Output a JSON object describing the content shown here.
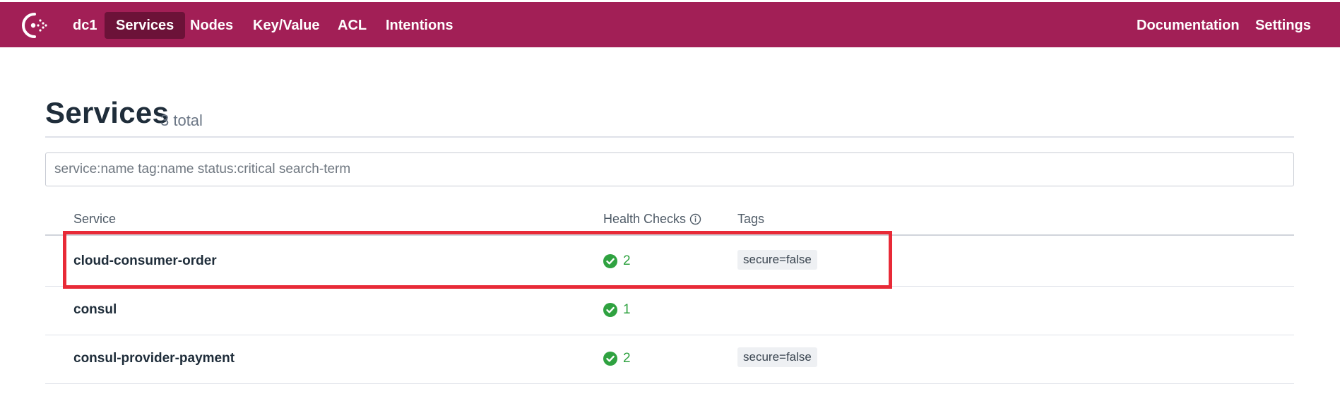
{
  "nav": {
    "datacenter": "dc1",
    "items": [
      "Services",
      "Nodes",
      "Key/Value",
      "ACL",
      "Intentions"
    ],
    "active": "Services",
    "right_items": [
      "Documentation",
      "Settings"
    ],
    "brand_color": "#a21f56",
    "logo_icon": "consul-logo-icon"
  },
  "page": {
    "title": "Services",
    "count": "3 total"
  },
  "search": {
    "placeholder": "service:name tag:name status:critical search-term",
    "value": ""
  },
  "table": {
    "headers": {
      "service": "Service",
      "health": "Health Checks",
      "tags": "Tags"
    },
    "rows": [
      {
        "name": "cloud-consumer-order",
        "checks": "2",
        "status": "passing",
        "tag": "secure=false"
      },
      {
        "name": "consul",
        "checks": "1",
        "status": "passing",
        "tag": ""
      },
      {
        "name": "consul-provider-payment",
        "checks": "2",
        "status": "passing",
        "tag": "secure=false"
      }
    ]
  },
  "highlight": {
    "color": "#e82a37",
    "row_name": "cloud-consumer-order"
  }
}
